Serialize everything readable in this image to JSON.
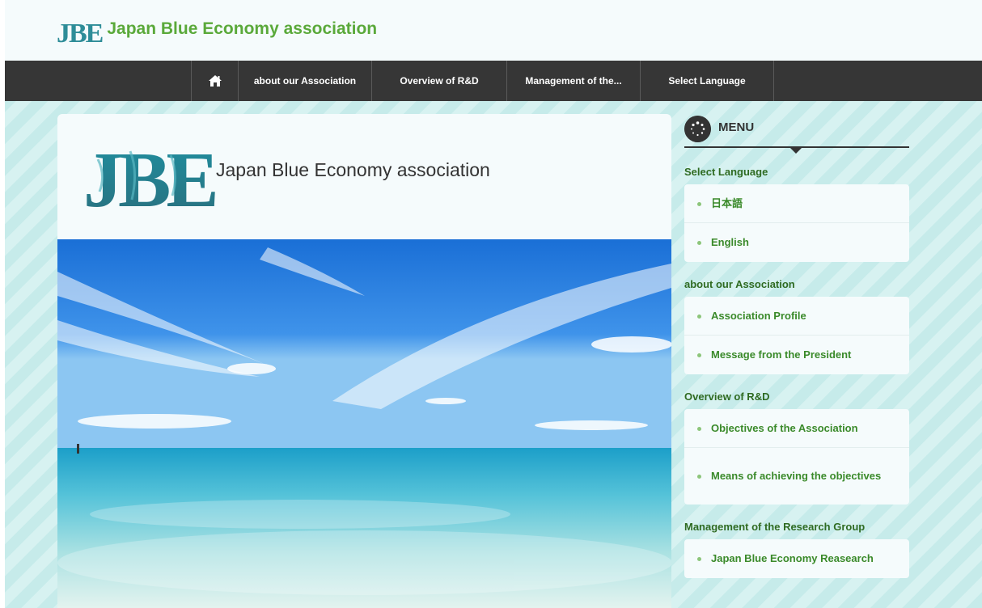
{
  "header": {
    "logo_text": "JBE",
    "site_title": "Japan Blue Economy association"
  },
  "nav": {
    "items": [
      {
        "label": "about our Association"
      },
      {
        "label": "Overview of R&D"
      },
      {
        "label": "Management of the..."
      },
      {
        "label": "Select Language"
      }
    ]
  },
  "main": {
    "card_logo_text": "JBE",
    "card_title": "Japan Blue Economy association"
  },
  "sidebar": {
    "menu_label": "MENU",
    "sections": [
      {
        "title": "Select Language",
        "items": [
          "日本語",
          "English"
        ]
      },
      {
        "title": "about our Association",
        "items": [
          "Association Profile",
          "Message from the President"
        ]
      },
      {
        "title": "Overview of R&D",
        "items": [
          "Objectives of the Association",
          "Means of achieving the objectives"
        ]
      },
      {
        "title": "Management of the Research Group",
        "items": [
          "Japan Blue Economy Reasearch"
        ]
      }
    ]
  },
  "colors": {
    "accent_green": "#5aa93a",
    "link_green": "#3a8a2a",
    "nav_bg": "#363636",
    "logo_teal": "#2e8d98"
  },
  "icons": {
    "home": "home-icon",
    "menu": "spinner-icon",
    "bullet": "dot-icon"
  }
}
